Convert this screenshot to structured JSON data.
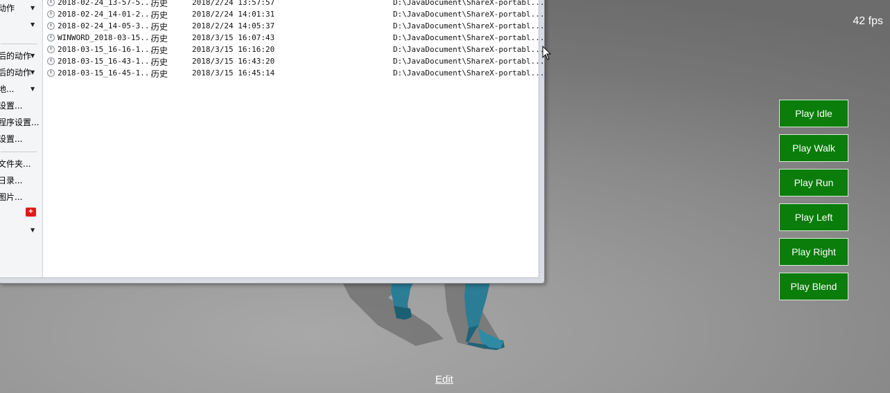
{
  "fps": "42 fps",
  "buttons": {
    "idle": "Play Idle",
    "walk": "Play Walk",
    "run": "Play Run",
    "left": "Play Left",
    "right": "Play Right",
    "blend": "Play Blend"
  },
  "edit_link": "Edit",
  "menu": {
    "items": [
      "动作",
      "",
      "后的动作",
      "后的动作",
      "地...",
      "设置...",
      "程序设置...",
      "设置...",
      "文件夹...",
      "日录...",
      "图片...",
      "",
      ""
    ]
  },
  "history": {
    "rows": [
      {
        "name": "2018-02-24_13-57-5...",
        "type": "历史",
        "date": "2018/2/24 13:57:57",
        "path": "D:\\JavaDocument\\ShareX-portabl..."
      },
      {
        "name": "2018-02-24_14-01-2...",
        "type": "历史",
        "date": "2018/2/24 14:01:31",
        "path": "D:\\JavaDocument\\ShareX-portabl..."
      },
      {
        "name": "2018-02-24_14-05-3...",
        "type": "历史",
        "date": "2018/2/24 14:05:37",
        "path": "D:\\JavaDocument\\ShareX-portabl..."
      },
      {
        "name": "WINWORD_2018-03-15...",
        "type": "历史",
        "date": "2018/3/15 16:07:43",
        "path": "D:\\JavaDocument\\ShareX-portabl..."
      },
      {
        "name": "2018-03-15_16-16-1...",
        "type": "历史",
        "date": "2018/3/15 16:16:20",
        "path": "D:\\JavaDocument\\ShareX-portabl..."
      },
      {
        "name": "2018-03-15_16-43-1...",
        "type": "历史",
        "date": "2018/3/15 16:43:20",
        "path": "D:\\JavaDocument\\ShareX-portabl..."
      },
      {
        "name": "2018-03-15_16-45-1...",
        "type": "历史",
        "date": "2018/3/15 16:45:14",
        "path": "D:\\JavaDocument\\ShareX-portabl..."
      }
    ]
  },
  "colors": {
    "button_bg": "#0a7d0a",
    "character": "#2a7d95"
  }
}
